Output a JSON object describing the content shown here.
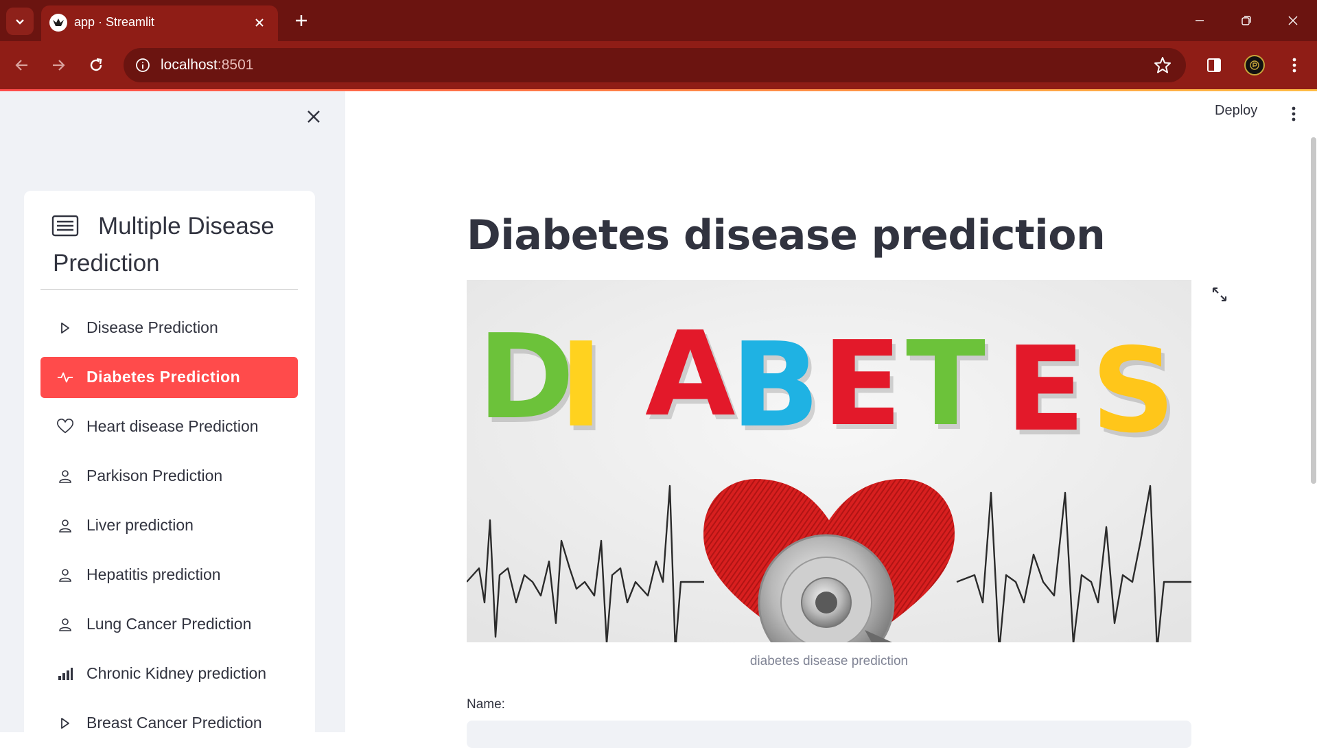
{
  "browser": {
    "tab_title": "app · Streamlit",
    "url_host": "localhost",
    "url_port": ":8501"
  },
  "sidebar": {
    "title": "Multiple Disease Prediction",
    "items": [
      {
        "label": "Disease Prediction",
        "icon": "play-outline-icon"
      },
      {
        "label": "Diabetes Prediction",
        "icon": "activity-icon",
        "active": true
      },
      {
        "label": "Heart disease Prediction",
        "icon": "heart-icon"
      },
      {
        "label": "Parkison Prediction",
        "icon": "person-icon"
      },
      {
        "label": "Liver prediction",
        "icon": "person-icon"
      },
      {
        "label": "Hepatitis prediction",
        "icon": "person-icon"
      },
      {
        "label": "Lung Cancer Prediction",
        "icon": "person-icon"
      },
      {
        "label": "Chronic Kidney prediction",
        "icon": "bar-chart-icon"
      },
      {
        "label": "Breast Cancer Prediction",
        "icon": "play-outline-icon"
      }
    ]
  },
  "header": {
    "deploy_label": "Deploy"
  },
  "main": {
    "title": "Diabetes disease prediction",
    "image_letters": [
      "D",
      "I",
      "A",
      "B",
      "E",
      "T",
      "E",
      "S"
    ],
    "image_caption": "diabetes disease prediction",
    "name_label": "Name:",
    "name_value": ""
  },
  "colors": {
    "chrome_dark": "#6b1410",
    "chrome": "#8f1d16",
    "accent": "#ff4b4b",
    "letters": [
      "#6cc23a",
      "#ffd21f",
      "#e3192a",
      "#1fb2e3",
      "#e3192a",
      "#6cc23a",
      "#e3192a",
      "#ffc61a"
    ]
  }
}
